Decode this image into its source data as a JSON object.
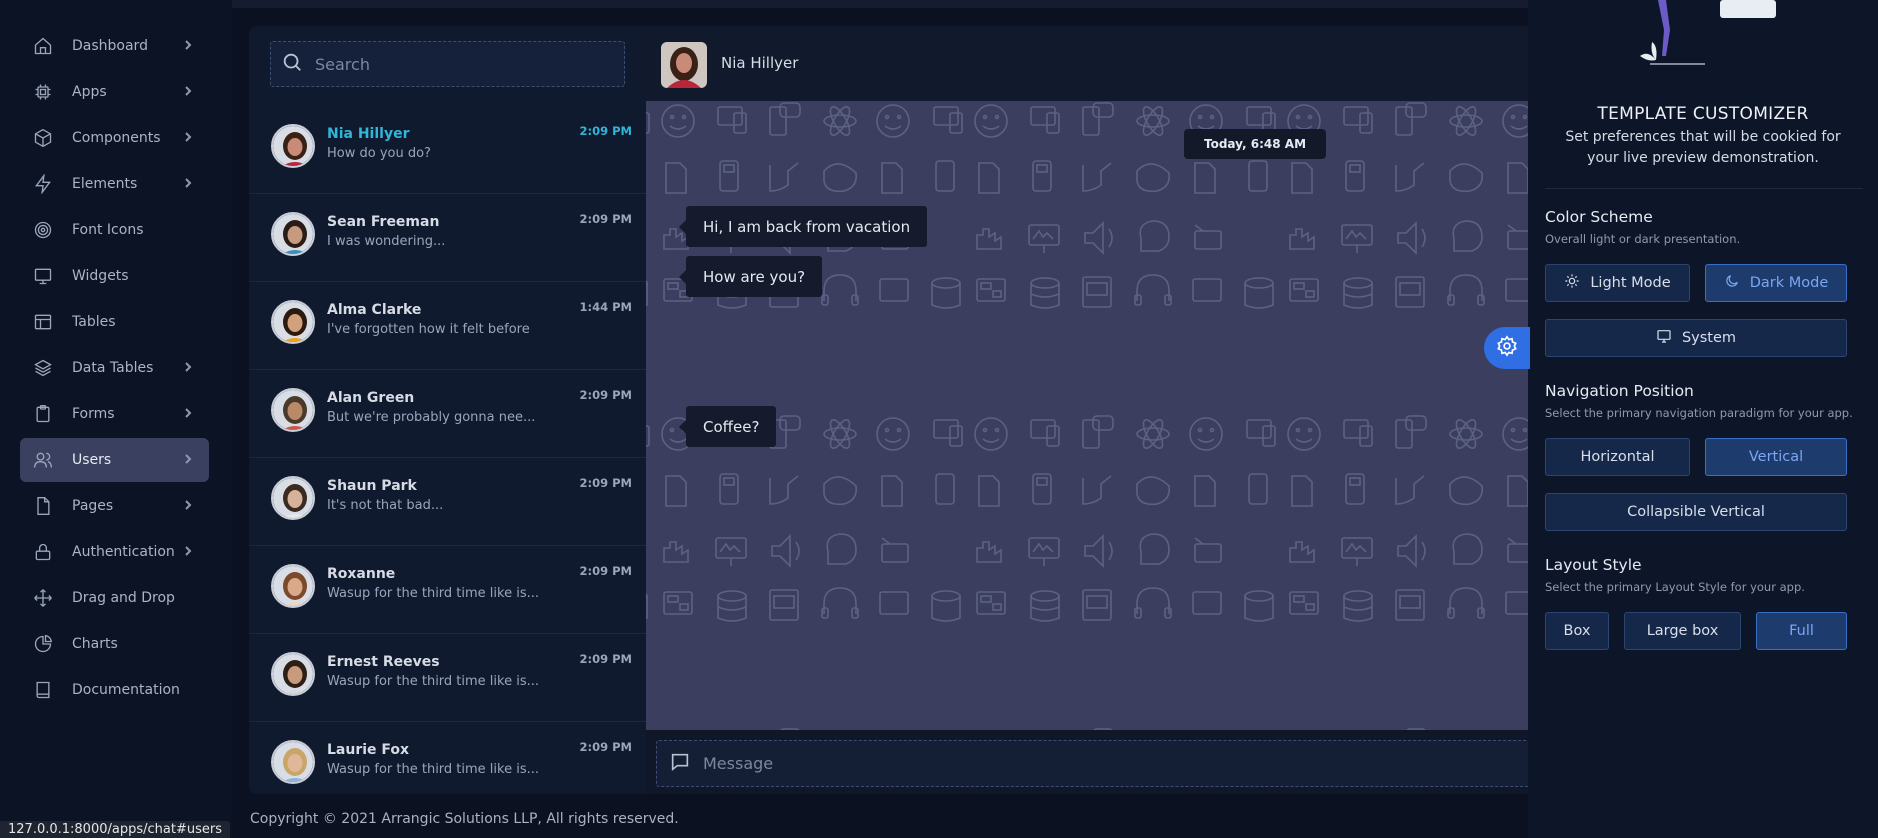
{
  "sidebar": {
    "items": [
      {
        "label": "Dashboard",
        "icon": "home-icon",
        "chevron": true
      },
      {
        "label": "Apps",
        "icon": "chip-icon",
        "chevron": true
      },
      {
        "label": "Components",
        "icon": "cube-icon",
        "chevron": true
      },
      {
        "label": "Elements",
        "icon": "bolt-icon",
        "chevron": true
      },
      {
        "label": "Font Icons",
        "icon": "target-icon",
        "chevron": false
      },
      {
        "label": "Widgets",
        "icon": "screen-icon",
        "chevron": false
      },
      {
        "label": "Tables",
        "icon": "table-icon",
        "chevron": false
      },
      {
        "label": "Data Tables",
        "icon": "layers-icon",
        "chevron": true
      },
      {
        "label": "Forms",
        "icon": "clipboard-icon",
        "chevron": true
      },
      {
        "label": "Users",
        "icon": "users-icon",
        "chevron": true,
        "active": true
      },
      {
        "label": "Pages",
        "icon": "file-icon",
        "chevron": true
      },
      {
        "label": "Authentication",
        "icon": "lock-icon",
        "chevron": true
      },
      {
        "label": "Drag and Drop",
        "icon": "move-icon",
        "chevron": false
      },
      {
        "label": "Charts",
        "icon": "pie-icon",
        "chevron": false
      },
      {
        "label": "Documentation",
        "icon": "book-icon",
        "chevron": false
      }
    ]
  },
  "search": {
    "placeholder": "Search"
  },
  "contacts": [
    {
      "name": "Nia Hillyer",
      "message": "How do you do?",
      "time": "2:09 PM",
      "active": true,
      "skin": "#c98a78",
      "hair": "#3a2116",
      "shirt": "#b8263a"
    },
    {
      "name": "Sean Freeman",
      "message": "I was wondering...",
      "time": "2:09 PM",
      "skin": "#c69a7e",
      "hair": "#2a1c14",
      "shirt": "#3c8fb8"
    },
    {
      "name": "Alma Clarke",
      "message": "I've forgotten how it felt before",
      "time": "1:44 PM",
      "skin": "#d3a07c",
      "hair": "#2b1a10",
      "shirt": "#f0a31a"
    },
    {
      "name": "Alan Green",
      "message": "But we're probably gonna nee...",
      "time": "2:09 PM",
      "skin": "#b98968",
      "hair": "#4a3a2c",
      "shirt": "#c9574a"
    },
    {
      "name": "Shaun Park",
      "message": "It's not that bad...",
      "time": "2:09 PM",
      "skin": "#d7b29a",
      "hair": "#3a2a20",
      "shirt": "#e8e8e8"
    },
    {
      "name": "Roxanne",
      "message": "Wasup for the third time like is...",
      "time": "2:09 PM",
      "skin": "#d9a98a",
      "hair": "#7a4a2a",
      "shirt": "#e9d8c8"
    },
    {
      "name": "Ernest Reeves",
      "message": "Wasup for the third time like is...",
      "time": "2:09 PM",
      "skin": "#c99a7c",
      "hair": "#2c1f16",
      "shirt": "#d8d8d8"
    },
    {
      "name": "Laurie Fox",
      "message": "Wasup for the third time like is...",
      "time": "2:09 PM",
      "skin": "#e0b899",
      "hair": "#c9a56a",
      "shirt": "#8bb4d8"
    }
  ],
  "chat": {
    "header_name": "Nia Hillyer",
    "date_badge": "Today, 6:48 AM",
    "messages": [
      {
        "text": "Hi, I am back from vacation"
      },
      {
        "text": "How are you?"
      },
      {
        "text": "Coffee?"
      }
    ],
    "message_placeholder": "Message"
  },
  "footer": {
    "copyright": "Copyright © 2021 Arrangic Solutions LLP, All rights reserved."
  },
  "statusbar": {
    "url": "127.0.0.1:8000/apps/chat#users"
  },
  "customizer": {
    "title": "TEMPLATE CUSTOMIZER",
    "subtitle": "Set preferences that will be cookied for your live preview demonstration.",
    "color_scheme": {
      "title": "Color Scheme",
      "sub": "Overall light or dark presentation.",
      "light": "Light Mode",
      "dark": "Dark Mode",
      "system": "System",
      "selected": "dark"
    },
    "navigation": {
      "title": "Navigation Position",
      "sub": "Select the primary navigation paradigm for your app.",
      "horizontal": "Horizontal",
      "vertical": "Vertical",
      "collapsible": "Collapsible Vertical",
      "selected": "vertical"
    },
    "layout": {
      "title": "Layout Style",
      "sub": "Select the primary Layout Style for your app.",
      "box": "Box",
      "large_box": "Large box",
      "full": "Full",
      "selected": "full"
    },
    "accent_color": "#2f6fe3"
  }
}
